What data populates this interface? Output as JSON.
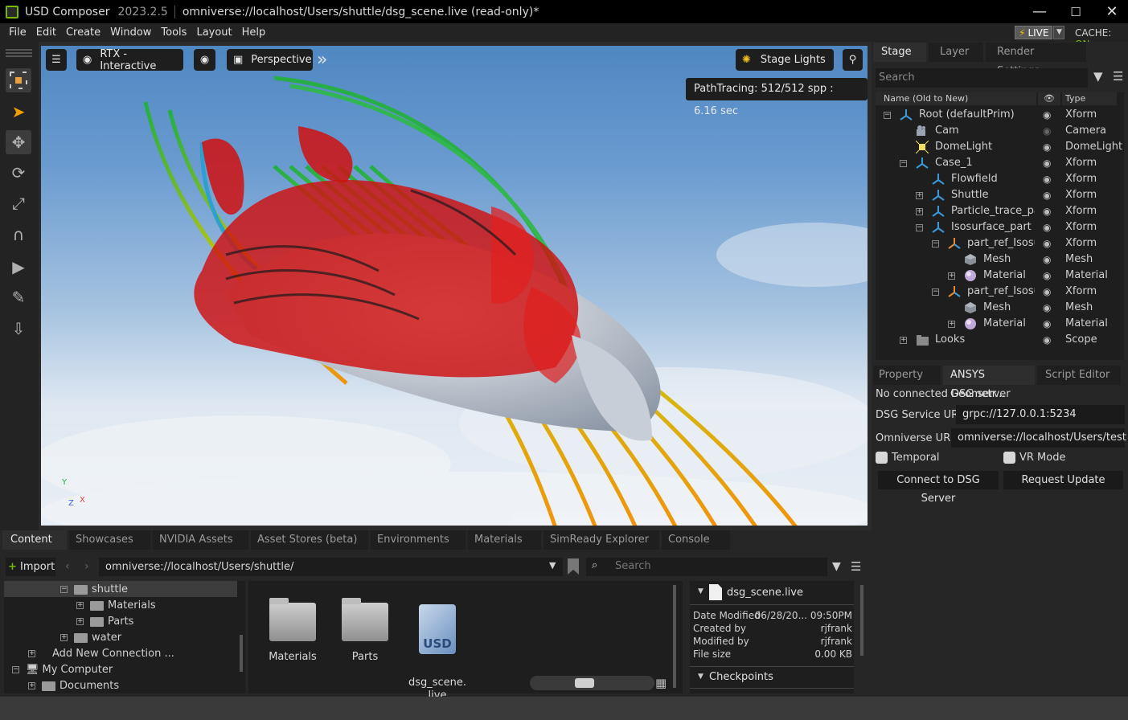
{
  "titlebar": {
    "app": "USD Composer",
    "version": "2023.2.5",
    "path": "omniverse://localhost/Users/shuttle/dsg_scene.live (read-only)*",
    "minimize": "—",
    "maximize": "☐",
    "close": "✕"
  },
  "menu": [
    "File",
    "Edit",
    "Create",
    "Window",
    "Tools",
    "Layout",
    "Help"
  ],
  "live": {
    "label": "LIVE",
    "cache_label": "CACHE:",
    "cache_state": "ON"
  },
  "viewport": {
    "render_mode": "RTX - Interactive",
    "camera": "Perspective",
    "stage_lights": "Stage Lights",
    "pathtracing": "PathTracing: 512/512 spp : 6.16 sec",
    "axis_x": "X",
    "axis_y": "Y",
    "axis_z": "Z"
  },
  "stage": {
    "tabs": [
      "Stage",
      "Layer",
      "Render Settings"
    ],
    "search_placeholder": "Search",
    "col_name": "Name (Old to New)",
    "col_type": "Type",
    "rows": [
      {
        "name": "Root (defaultPrim)",
        "type": "Xform",
        "icon": "xform-icon",
        "depth": 0,
        "exp": "−"
      },
      {
        "name": "Cam",
        "type": "Camera",
        "icon": "camera-icon",
        "depth": 1,
        "exp": ""
      },
      {
        "name": "DomeLight",
        "type": "DomeLight",
        "icon": "light-icon",
        "depth": 1,
        "exp": ""
      },
      {
        "name": "Case_1",
        "type": "Xform",
        "icon": "xform-icon",
        "depth": 1,
        "exp": "−"
      },
      {
        "name": "Flowfield",
        "type": "Xform",
        "icon": "xform-icon",
        "depth": 2,
        "exp": ""
      },
      {
        "name": "Shuttle",
        "type": "Xform",
        "icon": "xform-icon",
        "depth": 2,
        "exp": "+"
      },
      {
        "name": "Particle_trace_part",
        "type": "Xform",
        "icon": "xform-icon",
        "depth": 2,
        "exp": "+"
      },
      {
        "name": "Isosurface_part",
        "type": "Xform",
        "icon": "xform-icon",
        "depth": 2,
        "exp": "−"
      },
      {
        "name": "part_ref_Isosurfa",
        "type": "Xform",
        "icon": "xform-orange-icon",
        "depth": 3,
        "exp": "−"
      },
      {
        "name": "Mesh",
        "type": "Mesh",
        "icon": "mesh-icon",
        "depth": 4,
        "exp": ""
      },
      {
        "name": "Material",
        "type": "Material",
        "icon": "material-icon",
        "depth": 4,
        "exp": "+"
      },
      {
        "name": "part_ref_Isosurfa",
        "type": "Xform",
        "icon": "xform-orange-icon",
        "depth": 3,
        "exp": "−"
      },
      {
        "name": "Mesh",
        "type": "Mesh",
        "icon": "mesh-icon",
        "depth": 4,
        "exp": ""
      },
      {
        "name": "Material",
        "type": "Material",
        "icon": "material-icon",
        "depth": 4,
        "exp": "+"
      },
      {
        "name": "Looks",
        "type": "Scope",
        "icon": "folder-icon",
        "depth": 1,
        "exp": "+"
      }
    ]
  },
  "property": {
    "tabs": [
      "Property",
      "ANSYS Geometr...",
      "Script Editor"
    ],
    "status": "No connected DSG server",
    "dsg_uri_label": "DSG Service URI:",
    "dsg_uri_value": "grpc://127.0.0.1:5234",
    "omni_uri_label": "Omniverse URI:",
    "omni_uri_value": "omniverse://localhost/Users/test",
    "temporal": "Temporal",
    "vr_mode": "VR Mode",
    "connect_btn": "Connect to DSG Server",
    "update_btn": "Request Update"
  },
  "content": {
    "tabs": [
      "Content",
      "Showcases",
      "NVIDIA Assets",
      "Asset Stores (beta)",
      "Environments",
      "Materials",
      "SimReady Explorer",
      "Console"
    ],
    "import": "Import",
    "path": "omniverse://localhost/Users/shuttle/",
    "search_placeholder": "Search",
    "tree": [
      {
        "label": "shuttle",
        "exp": "−"
      },
      {
        "label": "Materials",
        "exp": "+"
      },
      {
        "label": "Parts",
        "exp": "+"
      },
      {
        "label": "water",
        "exp": "+"
      },
      {
        "label": "Add New Connection ...",
        "exp": "+"
      },
      {
        "label": "My Computer",
        "exp": "−"
      },
      {
        "label": "Documents",
        "exp": "+"
      }
    ],
    "items": [
      {
        "label": "Materials"
      },
      {
        "label": "Parts"
      },
      {
        "label": "dsg_scene.\nlive"
      }
    ],
    "detail": {
      "filename": "dsg_scene.live",
      "date_label": "Date Modified",
      "date_value": "06/28/20... 09:50PM",
      "created_label": "Created by",
      "created_value": "rjfrank",
      "modified_label": "Modified by",
      "modified_value": "rjfrank",
      "size_label": "File size",
      "size_value": "0.00 KB",
      "checkpoints": "Checkpoints"
    }
  },
  "colors": {
    "accent": "#76b900",
    "live_bolt": "#f5c400"
  }
}
